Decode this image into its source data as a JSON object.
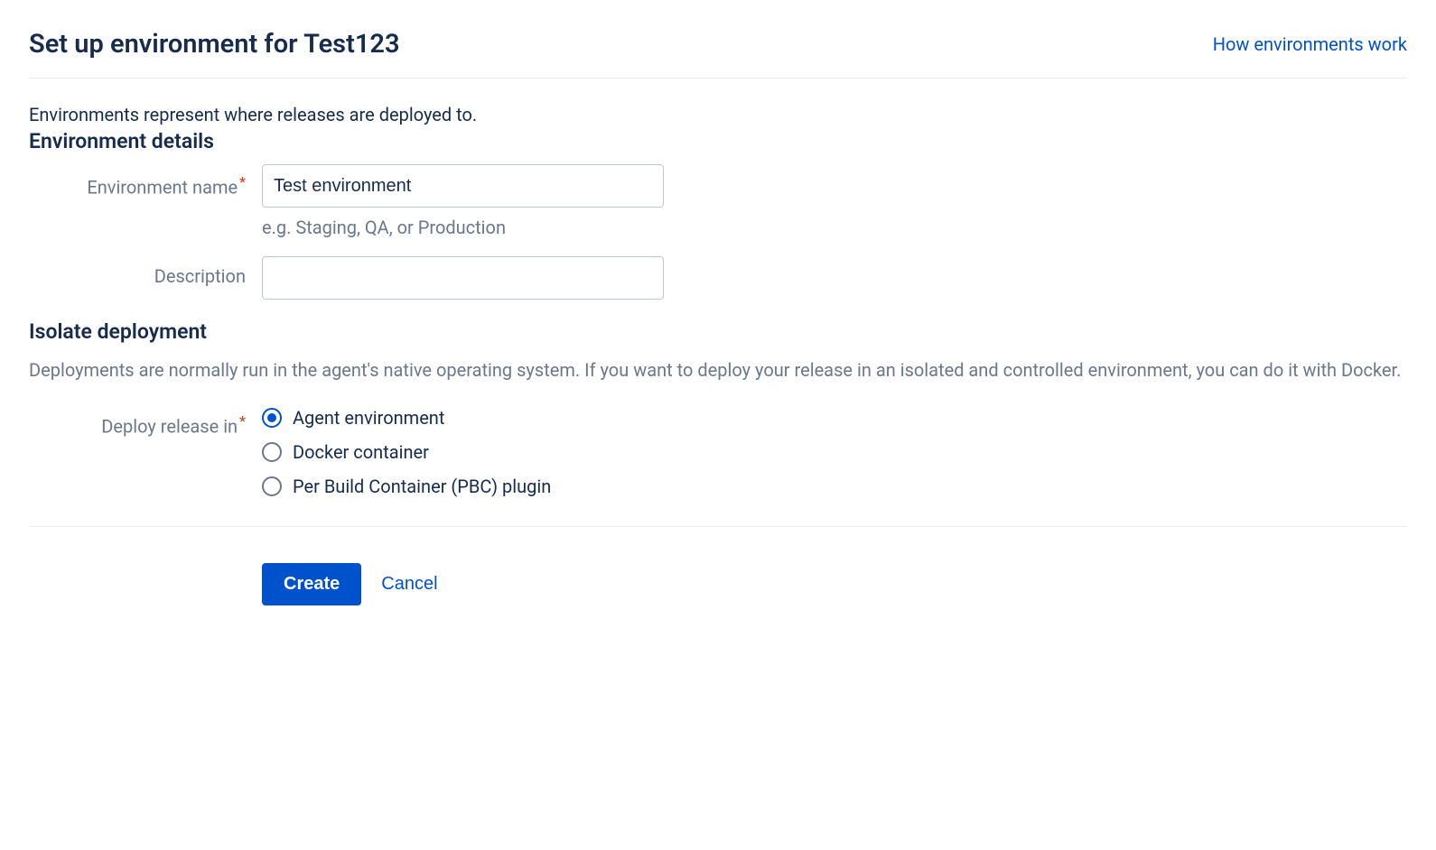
{
  "header": {
    "title": "Set up environment for Test123",
    "help_link": "How environments work"
  },
  "intro": "Environments represent where releases are deployed to.",
  "env_details": {
    "heading": "Environment details",
    "name_label": "Environment name",
    "name_value": "Test environment",
    "name_hint": "e.g. Staging, QA, or Production",
    "description_label": "Description",
    "description_value": ""
  },
  "isolate": {
    "heading": "Isolate deployment",
    "description": "Deployments are normally run in the agent's native operating system. If you want to deploy your release in an isolated and controlled environment, you can do it with Docker.",
    "label": "Deploy release in",
    "options": [
      {
        "label": "Agent environment",
        "selected": true
      },
      {
        "label": "Docker container",
        "selected": false
      },
      {
        "label": "Per Build Container (PBC) plugin",
        "selected": false
      }
    ]
  },
  "actions": {
    "create": "Create",
    "cancel": "Cancel"
  }
}
